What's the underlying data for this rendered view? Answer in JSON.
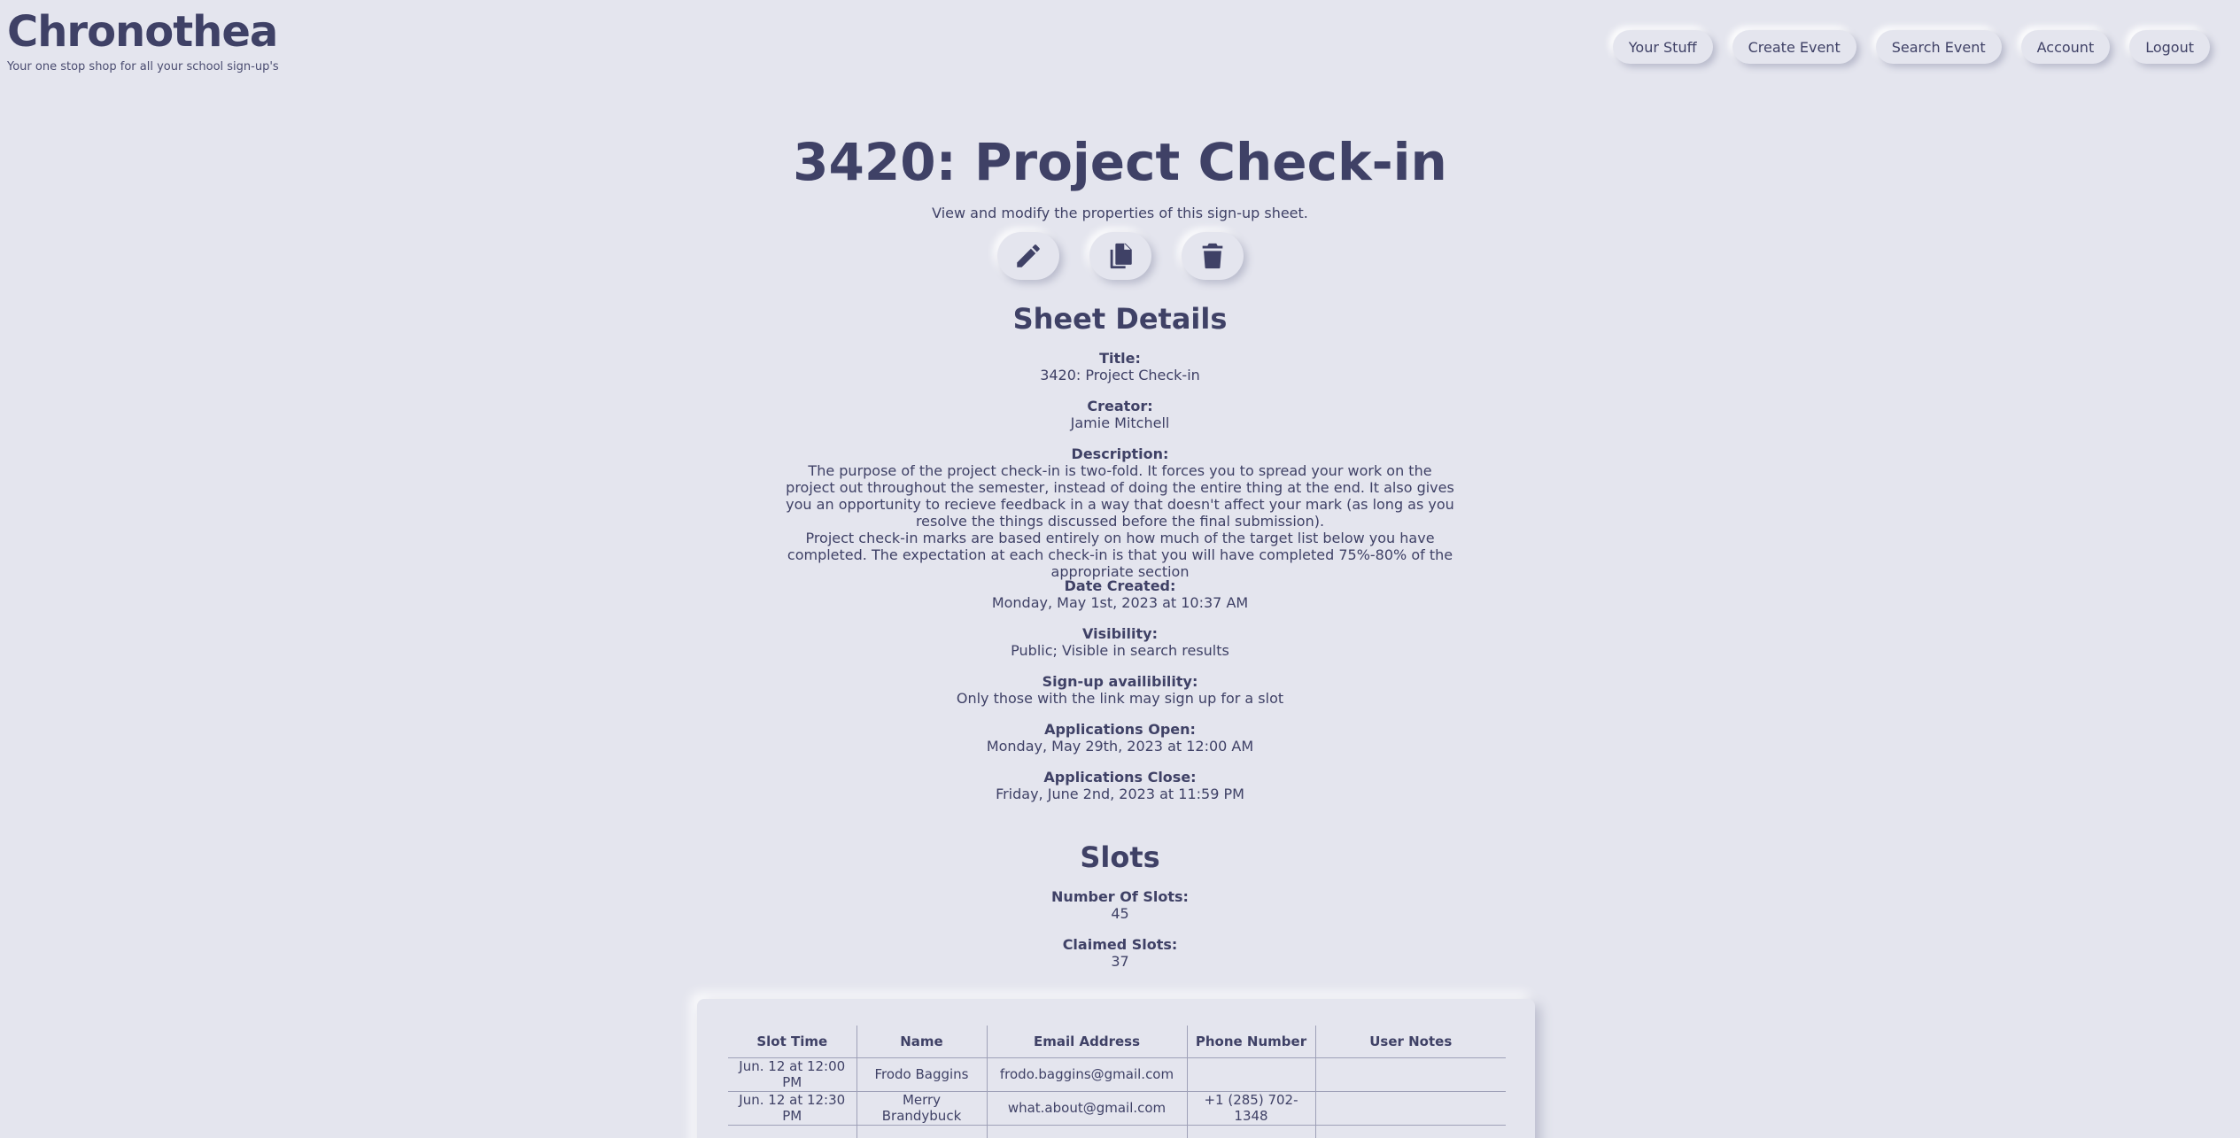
{
  "brand": {
    "title": "Chronothea",
    "tagline": "Your one stop shop for all your school sign-up's"
  },
  "nav": [
    "Your Stuff",
    "Create Event",
    "Search Event",
    "Account",
    "Logout"
  ],
  "page": {
    "title": "3420: Project Check-in",
    "subtitle": "View and modify the properties of this sign-up sheet."
  },
  "actions": {
    "edit_icon": "pencil-icon",
    "copy_icon": "copy-icon",
    "delete_icon": "trash-icon"
  },
  "details": {
    "heading": "Sheet Details",
    "title_label": "Title:",
    "title_value": "3420: Project Check-in",
    "creator_label": "Creator:",
    "creator_value": "Jamie Mitchell",
    "description_label": "Description:",
    "description_p1": "The purpose of the project check-in is two-fold. It forces you to spread your work on the project out throughout the semester, instead of doing the entire thing at the end. It also gives you an opportunity to recieve feedback in a way that doesn't affect your mark (as long as you resolve the things discussed before the final submission).",
    "description_p2": "Project check-in marks are based entirely on how much of the target list below you have completed. The expectation at each check-in is that you will have completed 75%-80% of the appropriate section",
    "date_created_label": "Date Created:",
    "date_created_value": "Monday, May 1st, 2023 at 10:37 AM",
    "visibility_label": "Visibility:",
    "visibility_value": "Public; Visible in search results",
    "signup_label": "Sign-up availibility:",
    "signup_value": "Only those with the link may sign up for a slot",
    "open_label": "Applications Open:",
    "open_value": "Monday, May 29th, 2023 at 12:00 AM",
    "close_label": "Applications Close:",
    "close_value": "Friday, June 2nd, 2023 at 11:59 PM"
  },
  "slots": {
    "heading": "Slots",
    "number_label": "Number Of Slots:",
    "number_value": "45",
    "claimed_label": "Claimed Slots:",
    "claimed_value": "37",
    "columns": [
      "Slot Time",
      "Name",
      "Email Address",
      "Phone Number",
      "User Notes"
    ],
    "rows": [
      [
        "Jun. 12 at 12:00 PM",
        "Frodo Baggins",
        "frodo.baggins@gmail.com",
        "",
        ""
      ],
      [
        "Jun. 12 at 12:30 PM",
        "Merry Brandybuck",
        "what.about@gmail.com",
        "+1 (285) 702-1348",
        ""
      ],
      [
        "",
        "",
        "",
        "",
        ""
      ]
    ]
  },
  "colors": {
    "background": "#e4e5ee",
    "text": "#3f4166"
  }
}
